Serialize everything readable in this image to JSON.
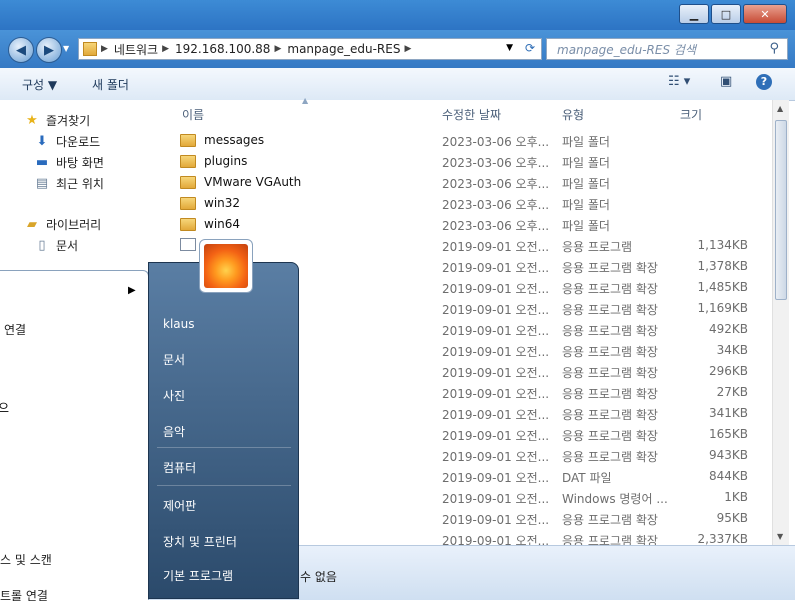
{
  "window": {
    "minimize": "▁",
    "maximize": "□",
    "close": "✕"
  },
  "address": {
    "crumbs": [
      "네트워크",
      "192.168.100.88",
      "manpage_edu-RES"
    ],
    "search_placeholder": "manpage_edu-RES 검색"
  },
  "toolbar": {
    "organize": "구성 ▼",
    "new_folder": "새 폴더"
  },
  "nav": {
    "favorites": "즐겨찾기",
    "downloads": "다운로드",
    "desktop": "바탕 화면",
    "recent": "최근 위치",
    "libraries": "라이브러리",
    "documents": "문서"
  },
  "columns": {
    "name": "이름",
    "date": "수정한 날짜",
    "type": "유형",
    "size": "크기"
  },
  "files": [
    {
      "name": "messages",
      "date": "2023-03-06 오후...",
      "type": "파일 폴더",
      "size": "",
      "kind": "folder"
    },
    {
      "name": "plugins",
      "date": "2023-03-06 오후...",
      "type": "파일 폴더",
      "size": "",
      "kind": "folder"
    },
    {
      "name": "VMware VGAuth",
      "date": "2023-03-06 오후...",
      "type": "파일 폴더",
      "size": "",
      "kind": "folder"
    },
    {
      "name": "win32",
      "date": "2023-03-06 오후...",
      "type": "파일 폴더",
      "size": "",
      "kind": "folder"
    },
    {
      "name": "win64",
      "date": "2023-03-06 오후...",
      "type": "파일 폴더",
      "size": "",
      "kind": "folder"
    },
    {
      "name": "",
      "date": "2019-09-01 오전...",
      "type": "응용 프로그램",
      "size": "1,134KB",
      "kind": "app"
    },
    {
      "name": "",
      "date": "2019-09-01 오전...",
      "type": "응용 프로그램 확장",
      "size": "1,378KB",
      "kind": "none"
    },
    {
      "name": "",
      "date": "2019-09-01 오전...",
      "type": "응용 프로그램 확장",
      "size": "1,485KB",
      "kind": "none"
    },
    {
      "name": "",
      "date": "2019-09-01 오전...",
      "type": "응용 프로그램 확장",
      "size": "1,169KB",
      "kind": "none"
    },
    {
      "name": "",
      "date": "2019-09-01 오전...",
      "type": "응용 프로그램 확장",
      "size": "492KB",
      "kind": "none"
    },
    {
      "name": "",
      "date": "2019-09-01 오전...",
      "type": "응용 프로그램 확장",
      "size": "34KB",
      "kind": "none"
    },
    {
      "name": "",
      "date": "2019-09-01 오전...",
      "type": "응용 프로그램 확장",
      "size": "296KB",
      "kind": "none"
    },
    {
      "name": "",
      "date": "2019-09-01 오전...",
      "type": "응용 프로그램 확장",
      "size": "27KB",
      "kind": "none"
    },
    {
      "name": "",
      "date": "2019-09-01 오전...",
      "type": "응용 프로그램 확장",
      "size": "341KB",
      "kind": "none"
    },
    {
      "name": "",
      "date": "2019-09-01 오전...",
      "type": "응용 프로그램 확장",
      "size": "165KB",
      "kind": "none"
    },
    {
      "name": "",
      "date": "2019-09-01 오전...",
      "type": "응용 프로그램 확장",
      "size": "943KB",
      "kind": "none"
    },
    {
      "name": "",
      "date": "2019-09-01 오전...",
      "type": "DAT 파일",
      "size": "844KB",
      "kind": "none"
    },
    {
      "name": "",
      "date": "2019-09-01 오전...",
      "type": "Windows 명령어 ...",
      "size": "1KB",
      "kind": "none"
    },
    {
      "name": "",
      "date": "2019-09-01 오전...",
      "type": "응용 프로그램 확장",
      "size": "95KB",
      "kind": "none"
    },
    {
      "name": "",
      "date": "2019-09-01 오전...",
      "type": "응용 프로그램 확장",
      "size": "2,337KB",
      "kind": "none"
    }
  ],
  "status_text": "수 없음",
  "start_left": {
    "item1": "연결",
    "item2": "스 및 스캔",
    "item3": "트롤 연결"
  },
  "start_right": {
    "user": "klaus",
    "documents": "문서",
    "pictures": "사진",
    "music": "음악",
    "computer": "컴퓨터",
    "control_panel": "제어판",
    "devices": "장치 및 프린터",
    "default_programs": "기본 프로그램"
  }
}
